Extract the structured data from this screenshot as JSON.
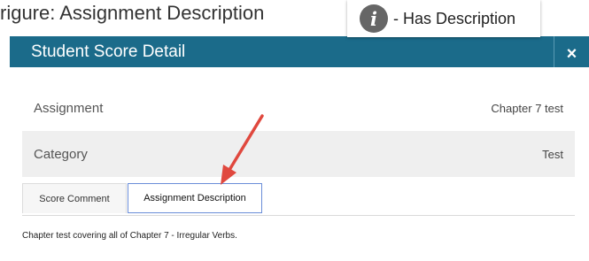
{
  "top_fragment": "rigure: Assignment Description",
  "legend": {
    "icon": "info-icon",
    "text": "- Has Description"
  },
  "modal": {
    "title": "Student Score Detail",
    "close_label": "×",
    "rows": [
      {
        "label": "Assignment",
        "value": "Chapter 7 test"
      },
      {
        "label": "Category",
        "value": "Test"
      }
    ],
    "tabs": [
      {
        "label": "Score Comment"
      },
      {
        "label": "Assignment Description"
      }
    ],
    "description": "Chapter test covering all of Chapter 7 - Irregular Verbs."
  },
  "colors": {
    "header": "#1b6b8a",
    "arrow": "#e0483e",
    "active_tab_border": "#6a8dd8"
  }
}
